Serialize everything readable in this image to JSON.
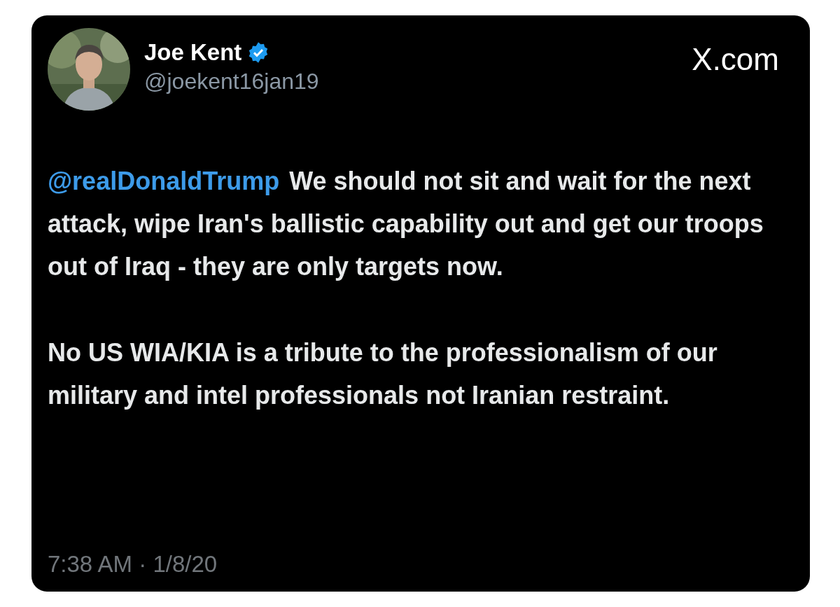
{
  "author": {
    "name": "Joe Kent",
    "verified": true,
    "handle": "@joekent16jan19"
  },
  "site": "X.com",
  "body": [
    {
      "mention": "@realDonaldTrump",
      "text": "We should not sit and wait for the next attack, wipe Iran's ballistic capability out and get our troops out of Iraq - they are only targets now."
    },
    {
      "text": "No US WIA/KIA is a tribute to the professionalism of our military and intel professionals not Iranian restraint."
    }
  ],
  "timestamp": "7:38 AM · 1/8/20"
}
